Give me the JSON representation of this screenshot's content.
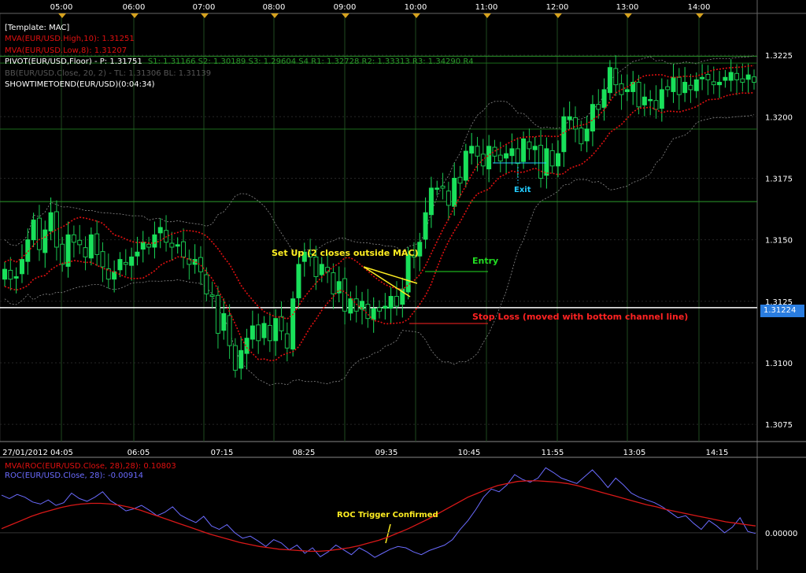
{
  "colors": {
    "background": "#000000",
    "grid": "#1f4a1f",
    "bull": "#19e05a",
    "bear": "#19e05a",
    "mva": "#e01010",
    "bollinger": "#8a8a8a",
    "pivot": "#2c9a2c",
    "roc": "#6b6bff",
    "roc_mva": "#d81818",
    "annotation_yellow": "#ffee22",
    "annotation_green": "#22dd22",
    "annotation_red": "#ff2222",
    "annotation_cyan": "#22ccff",
    "axis_text": "#ffffff",
    "price_tag": "#2a7de0"
  },
  "top_time_axis": [
    "05:00",
    "06:00",
    "07:00",
    "08:00",
    "09:00",
    "10:00",
    "11:00",
    "12:00",
    "13:00",
    "14:00"
  ],
  "bottom_time_axis": [
    "27/01/2012 04:05",
    "06:05",
    "07:15",
    "08:25",
    "09:35",
    "10:45",
    "11:55",
    "13:05",
    "14:15"
  ],
  "legend": [
    {
      "text": "[Template: MAC]",
      "color": "#ffffff"
    },
    {
      "text": "MVA(EUR/USD.High,10): 1.31251",
      "color": "#e01010"
    },
    {
      "text": "MVA(EUR/USD.Low,8): 1.31207",
      "color": "#e01010"
    },
    {
      "text": "PIVOT(EUR/USD,Floor) -  P: 1.31751",
      "color": "#ffffff"
    },
    {
      "text": "S1: 1.31166  S2: 1.30189  S3: 1.29604  S4  R1: 1.32728  R2: 1.33313  R3: 1.34290  R4",
      "color": "#2c9a2c"
    },
    {
      "text": "BB(EUR/USD.Close, 20, 2) -  TL: 1.31306  BL: 1.31139",
      "color": "#555555"
    },
    {
      "text": "SHOWTIMETOEND(EUR/USD)(0:04:34)",
      "color": "#ffffff"
    }
  ],
  "indicator_legend": [
    {
      "text": "MVA(ROC(EUR/USD.Close, 28),28): 0.10803",
      "color": "#e01010"
    },
    {
      "text": "ROC(EUR/USD.Close, 28): -0.00914",
      "color": "#6b6bff"
    }
  ],
  "annotations": {
    "setup": "Set Up (2 closes outside MAC)",
    "entry": "Entry",
    "stop_loss": "Stop Loss (moved with bottom channel line)",
    "exit": "Exit",
    "roc_trigger": "ROC Trigger Confirmed"
  },
  "current_price_tag": "1.31224",
  "zero_label": "0.00000",
  "chart_data": [
    {
      "type": "candlestick",
      "symbol": "EUR/USD",
      "date": "27/01/2012",
      "ylim": [
        1.3068,
        1.3242
      ],
      "yticks": [
        "1.3075",
        "1.3100",
        "1.3125",
        "1.3150",
        "1.3175",
        "1.3200",
        "1.3225"
      ],
      "pivot_levels": {
        "P": 1.31751,
        "S1": 1.31166,
        "R1": 1.32728,
        "R1_line": 1.3224,
        "S1_line": 1.313
      },
      "closes": [
        1.3138,
        1.3134,
        1.3135,
        1.3142,
        1.315,
        1.3158,
        1.3146,
        1.3154,
        1.3161,
        1.3147,
        1.314,
        1.3152,
        1.3149,
        1.3148,
        1.3143,
        1.3152,
        1.3144,
        1.3139,
        1.3134,
        1.3137,
        1.3142,
        1.314,
        1.3143,
        1.3145,
        1.3149,
        1.3147,
        1.3152,
        1.3155,
        1.3149,
        1.3147,
        1.3148,
        1.3143,
        1.314,
        1.3142,
        1.3137,
        1.3128,
        1.3127,
        1.3112,
        1.312,
        1.3107,
        1.3097,
        1.3105,
        1.311,
        1.3115,
        1.3109,
        1.3116,
        1.3109,
        1.3118,
        1.3113,
        1.3106,
        1.3126,
        1.314,
        1.3145,
        1.3143,
        1.3135,
        1.314,
        1.3137,
        1.3128,
        1.3133,
        1.3121,
        1.3126,
        1.3121,
        1.3125,
        1.3118,
        1.3122,
        1.3121,
        1.3123,
        1.3127,
        1.3123,
        1.313,
        1.3144,
        1.3143,
        1.3149,
        1.3161,
        1.3171,
        1.3171,
        1.3171,
        1.3164,
        1.3175,
        1.3173,
        1.3186,
        1.3188,
        1.3184,
        1.318,
        1.3188,
        1.3184,
        1.3182,
        1.3185,
        1.3187,
        1.3181,
        1.3191,
        1.3187,
        1.3188,
        1.3175,
        1.3187,
        1.318,
        1.3185,
        1.32,
        1.32,
        1.3195,
        1.3189,
        1.3195,
        1.3205,
        1.3203,
        1.3211,
        1.322,
        1.3213,
        1.3209,
        1.3211,
        1.3214,
        1.3204,
        1.3208,
        1.3207,
        1.3203,
        1.3211,
        1.3211,
        1.3216,
        1.3209,
        1.3214,
        1.3211,
        1.3215,
        1.3216,
        1.3215,
        1.3213,
        1.3214,
        1.3216,
        1.3218,
        1.3215,
        1.3214,
        1.3217,
        1.3214
      ],
      "roc_panel": {
        "roc": [
          0.55,
          0.5,
          0.56,
          0.52,
          0.45,
          0.42,
          0.48,
          0.4,
          0.44,
          0.58,
          0.5,
          0.46,
          0.52,
          0.6,
          0.47,
          0.4,
          0.32,
          0.35,
          0.4,
          0.33,
          0.25,
          0.3,
          0.38,
          0.26,
          0.2,
          0.15,
          0.24,
          0.1,
          0.05,
          0.12,
          0.0,
          -0.08,
          -0.05,
          -0.12,
          -0.2,
          -0.1,
          -0.15,
          -0.25,
          -0.18,
          -0.3,
          -0.22,
          -0.35,
          -0.28,
          -0.18,
          -0.25,
          -0.32,
          -0.22,
          -0.28,
          -0.36,
          -0.3,
          -0.24,
          -0.2,
          -0.22,
          -0.28,
          -0.32,
          -0.26,
          -0.22,
          -0.18,
          -0.1,
          0.05,
          0.18,
          0.34,
          0.52,
          0.64,
          0.6,
          0.7,
          0.85,
          0.78,
          0.74,
          0.8,
          0.95,
          0.88,
          0.8,
          0.76,
          0.72,
          0.82,
          0.92,
          0.8,
          0.66,
          0.8,
          0.7,
          0.58,
          0.52,
          0.48,
          0.44,
          0.38,
          0.3,
          0.22,
          0.25,
          0.14,
          0.05,
          0.18,
          0.1,
          0.0,
          0.08,
          0.22,
          0.02,
          -0.01
        ],
        "roc_mva": [
          0.06,
          0.12,
          0.18,
          0.24,
          0.29,
          0.33,
          0.37,
          0.4,
          0.42,
          0.43,
          0.43,
          0.42,
          0.4,
          0.37,
          0.33,
          0.28,
          0.23,
          0.18,
          0.13,
          0.08,
          0.03,
          -0.02,
          -0.06,
          -0.1,
          -0.14,
          -0.17,
          -0.2,
          -0.22,
          -0.24,
          -0.25,
          -0.26,
          -0.27,
          -0.27,
          -0.26,
          -0.24,
          -0.22,
          -0.19,
          -0.15,
          -0.11,
          -0.06,
          0.0,
          0.06,
          0.13,
          0.2,
          0.28,
          0.36,
          0.44,
          0.52,
          0.58,
          0.64,
          0.69,
          0.72,
          0.75,
          0.76,
          0.76,
          0.75,
          0.74,
          0.72,
          0.69,
          0.65,
          0.61,
          0.57,
          0.53,
          0.49,
          0.45,
          0.41,
          0.38,
          0.34,
          0.31,
          0.28,
          0.25,
          0.22,
          0.19,
          0.16,
          0.14,
          0.12,
          0.1
        ],
        "zero": 0.0
      }
    }
  ]
}
